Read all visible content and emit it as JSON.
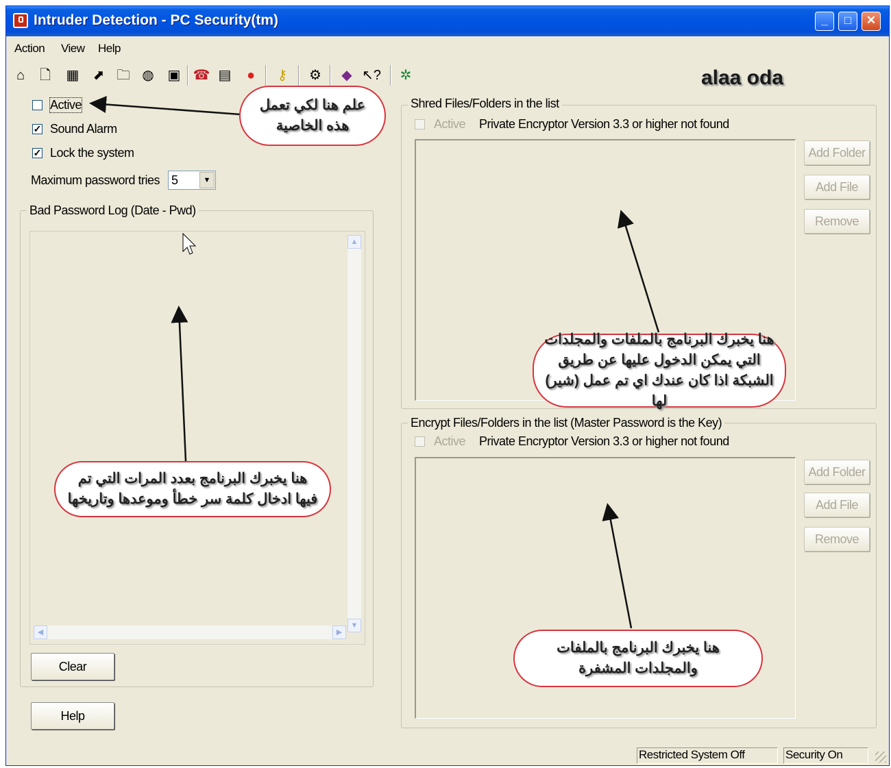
{
  "window": {
    "title": "Intruder Detection - PC Security(tm)",
    "minimize": "_",
    "maximize": "□",
    "close": "✕"
  },
  "menu": [
    "Action",
    "View",
    "Help"
  ],
  "toolbar_icons": [
    "home-icon",
    "new-document-icon",
    "film-icon",
    "shortcut-icon",
    "folder-icon",
    "globe-icon",
    "monitor-icon",
    "alarm-icon",
    "printer-icon",
    "stop-icon",
    "key-icon",
    "gear-icon",
    "book-icon",
    "help-cursor-icon",
    "tree-icon"
  ],
  "watermark": "alaa oda",
  "settings": {
    "active_label": "Active",
    "sound_alarm_label": "Sound Alarm",
    "lock_system_label": "Lock the system",
    "max_tries_label": "Maximum password tries",
    "max_tries_value": "5",
    "active_checked": false,
    "sound_alarm_checked": true,
    "lock_system_checked": true
  },
  "bad_log": {
    "title": "Bad Password Log (Date - Pwd)",
    "clear_label": "Clear"
  },
  "help_label": "Help",
  "shred": {
    "title": "Shred Files/Folders in the list",
    "active_label": "Active",
    "message": "Private Encryptor Version 3.3 or higher not found",
    "add_folder": "Add Folder",
    "add_file": "Add File",
    "remove": "Remove"
  },
  "encrypt": {
    "title": "Encrypt Files/Folders in the list (Master Password is the Key)",
    "active_label": "Active",
    "message": "Private Encryptor Version 3.3 or higher not found",
    "add_folder": "Add Folder",
    "add_file": "Add File",
    "remove": "Remove"
  },
  "annotations": {
    "active_note": "علم هنا لكي تعمل هذه الخاصية",
    "log_note": "هنا يخبرك البرنامج بعدد المرات التي تم فيها ادخال كلمة سر خطأ وموعدها وتاريخها",
    "shred_note": "هنا يخبرك البرنامج بالملفات والمجلدات التي يمكن الدخول عليها عن طريق الشبكة اذا كان عندك اي تم عمل (شير) لها",
    "encrypt_note": "هنا يخبرك البرنامج بالملفات والمجلدات المشفرة"
  },
  "status": {
    "restricted": "Restricted System Off",
    "security": "Security On"
  },
  "colors": {
    "titlebar": "#0054e3",
    "dialog_bg": "#ece9d8",
    "annotation_border": "#d8343e"
  }
}
